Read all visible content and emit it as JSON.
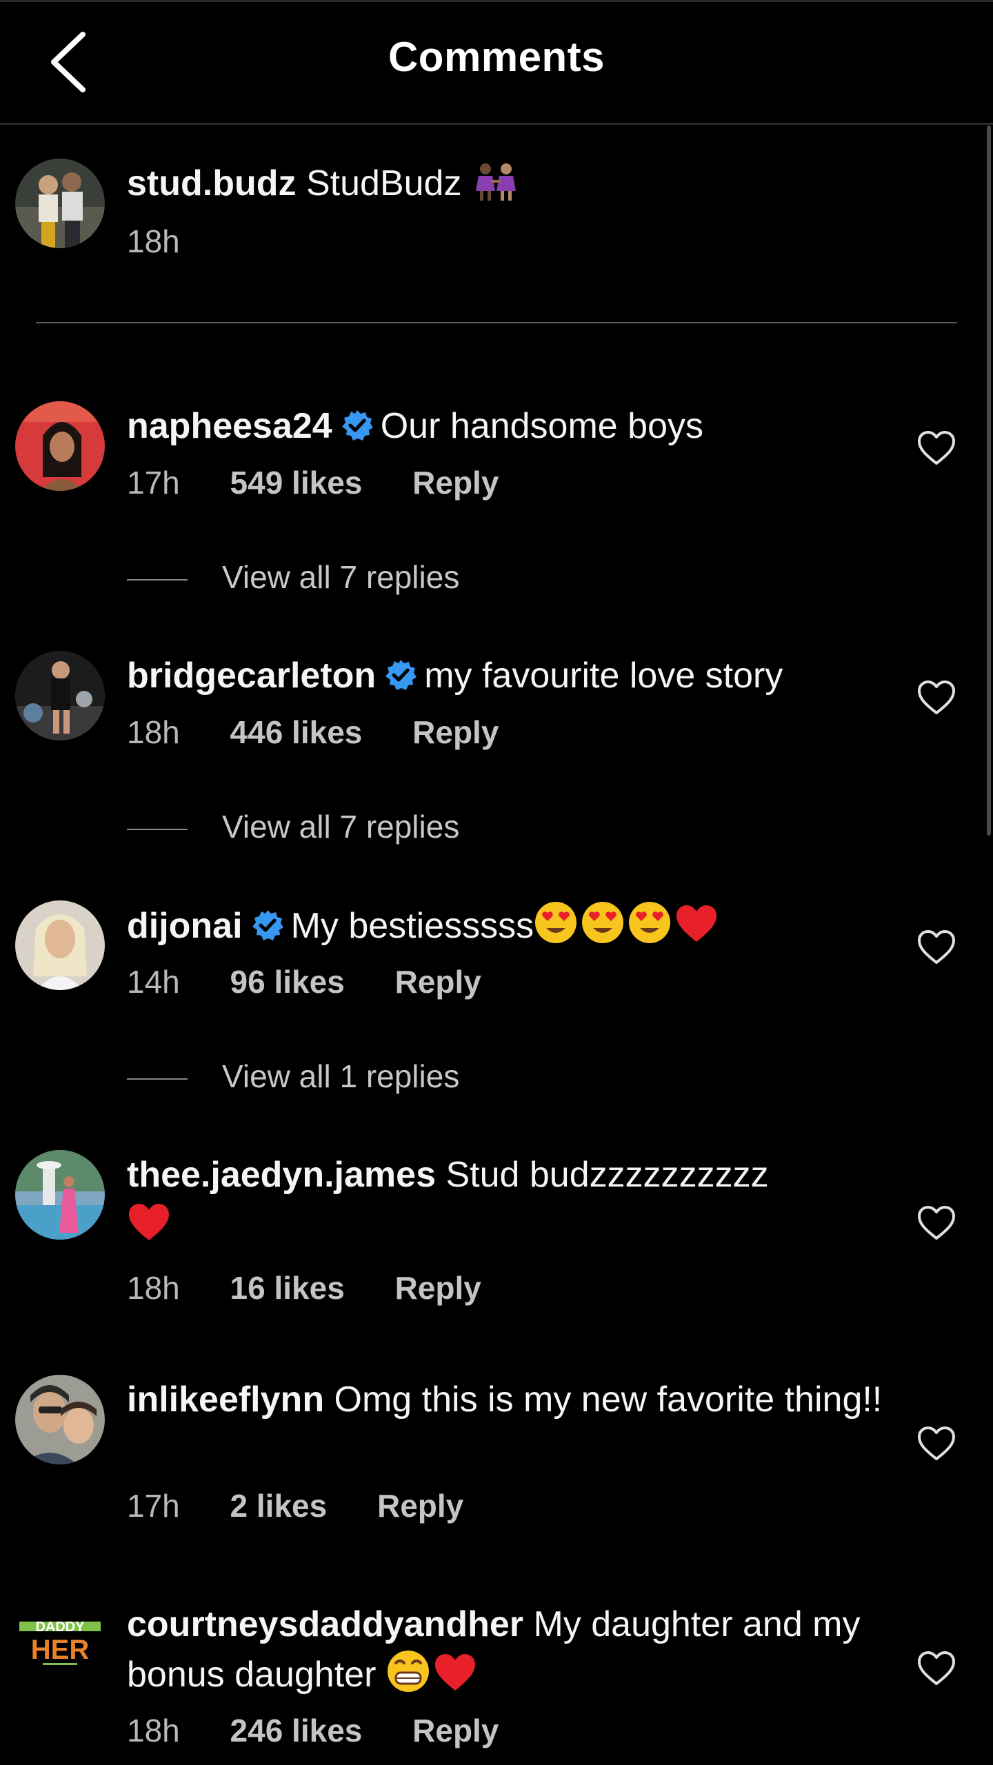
{
  "header": {
    "title": "Comments",
    "back_icon": "chevron-left-icon"
  },
  "caption": {
    "username": "stud.budz",
    "text": "StudBudz",
    "emoji": "two-women-holding-hands-emoji",
    "time": "18h"
  },
  "comments": [
    {
      "username": "napheesa24",
      "verified": true,
      "text": "Our handsome boys",
      "time": "17h",
      "likes": "549 likes",
      "reply": "Reply",
      "view_replies": "View all 7 replies"
    },
    {
      "username": "bridgecarleton",
      "verified": true,
      "text": "my favourite love story",
      "time": "18h",
      "likes": "446 likes",
      "reply": "Reply",
      "view_replies": "View all 7 replies"
    },
    {
      "username": "dijonai",
      "verified": true,
      "text": "My bestiesssss",
      "emojis": [
        "heart-eyes-emoji",
        "heart-eyes-emoji",
        "heart-eyes-emoji",
        "red-heart-emoji"
      ],
      "time": "14h",
      "likes": "96 likes",
      "reply": "Reply",
      "view_replies": "View all 1 replies"
    },
    {
      "username": "thee.jaedyn.james",
      "verified": false,
      "text": "Stud budzzzzzzzzzz",
      "emojis": [
        "red-heart-emoji"
      ],
      "time": "18h",
      "likes": "16 likes",
      "reply": "Reply"
    },
    {
      "username": "inlikeeflynn",
      "verified": false,
      "text": "Omg this is my new favorite thing!!",
      "time": "17h",
      "likes": "2 likes",
      "reply": "Reply"
    },
    {
      "username": "courtneysdaddyandher",
      "verified": false,
      "text": "My daughter and my bonus daughter",
      "emojis": [
        "grinning-face-emoji",
        "red-heart-emoji"
      ],
      "time": "18h",
      "likes": "246 likes",
      "reply": "Reply"
    }
  ],
  "avatar_logo": {
    "line1": "DADDY",
    "line2": "HER"
  },
  "colors": {
    "background": "#000000",
    "text_primary": "#f5f5f5",
    "text_secondary": "#b8b8b8",
    "verified_blue": "#3897f0",
    "heart_red": "#e8202a",
    "divider": "#5a5a5a"
  }
}
